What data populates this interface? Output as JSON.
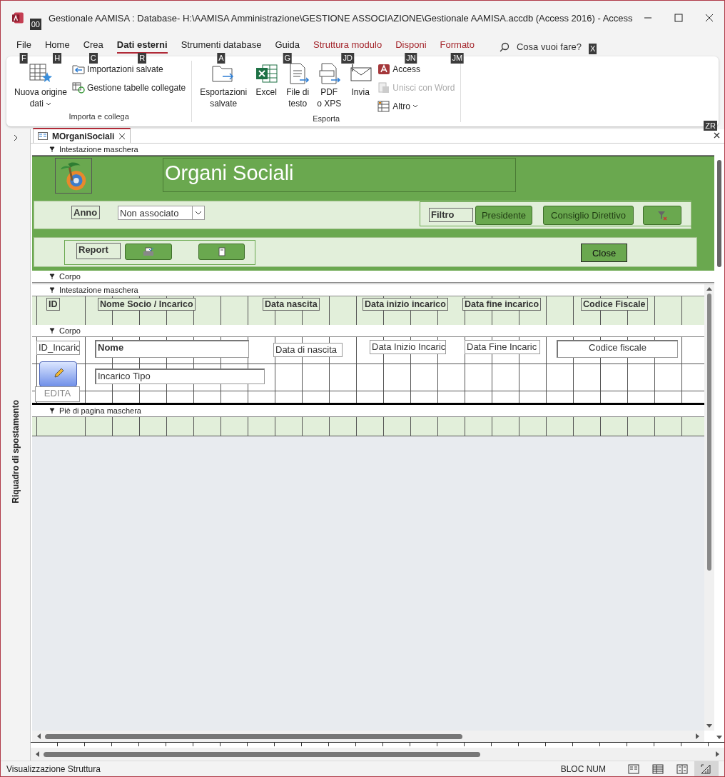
{
  "window": {
    "title": "Gestionale AAMISA : Database- H:\\AAMISA Amministrazione\\GESTIONE ASSOCIAZIONE\\Gestionale AAMISA.accdb (Access 2016)  -  Access",
    "qat_keytip": "00"
  },
  "menu_tabs": [
    {
      "label": "File",
      "keytip": "F",
      "selected": false,
      "kind": "normal"
    },
    {
      "label": "Home",
      "keytip": "H",
      "selected": false,
      "kind": "normal"
    },
    {
      "label": "Crea",
      "keytip": "C",
      "selected": false,
      "kind": "normal"
    },
    {
      "label": "Dati esterni",
      "keytip": "R",
      "selected": true,
      "kind": "normal"
    },
    {
      "label": "Strumenti database",
      "keytip": "A",
      "selected": false,
      "kind": "normal"
    },
    {
      "label": "Guida",
      "keytip": "G",
      "selected": false,
      "kind": "normal"
    },
    {
      "label": "Struttura modulo",
      "keytip": "JD",
      "selected": false,
      "kind": "contextual"
    },
    {
      "label": "Disponi",
      "keytip": "JN",
      "selected": false,
      "kind": "contextual"
    },
    {
      "label": "Formato",
      "keytip": "JM",
      "selected": false,
      "kind": "contextual"
    }
  ],
  "tell_me": {
    "placeholder": "Cosa vuoi fare?",
    "keytip": "X"
  },
  "ribbon": {
    "collapse_keytip": "ZR",
    "groups": [
      {
        "label": "Importa e collega",
        "items": [
          {
            "kind": "large",
            "lines": [
              "Nuova origine",
              "dati"
            ],
            "dropdown": true,
            "disabled": false
          },
          {
            "kind": "small",
            "label": "Importazioni salvate",
            "dropdown": false,
            "disabled": false
          },
          {
            "kind": "small",
            "label": "Gestione tabelle collegate",
            "dropdown": false,
            "disabled": false
          }
        ]
      },
      {
        "label": "Esporta",
        "items": [
          {
            "kind": "large",
            "lines": [
              "Esportazioni",
              "salvate"
            ],
            "dropdown": false,
            "disabled": false
          },
          {
            "kind": "large",
            "lines": [
              "Excel"
            ],
            "dropdown": false,
            "disabled": false
          },
          {
            "kind": "large",
            "lines": [
              "File di",
              "testo"
            ],
            "dropdown": false,
            "disabled": false
          },
          {
            "kind": "large",
            "lines": [
              "PDF",
              "o XPS"
            ],
            "dropdown": false,
            "disabled": false
          },
          {
            "kind": "large",
            "lines": [
              "Invia"
            ],
            "dropdown": false,
            "disabled": false
          },
          {
            "kind": "small",
            "label": "Access",
            "dropdown": false,
            "disabled": false
          },
          {
            "kind": "small",
            "label": "Unisci con Word",
            "dropdown": false,
            "disabled": true
          },
          {
            "kind": "small",
            "label": "Altro",
            "dropdown": true,
            "disabled": false
          }
        ]
      }
    ]
  },
  "navigation_pane": {
    "label": "Riquadro di spostamento"
  },
  "document_tab": {
    "label": "MOrganiSociali",
    "selected": true
  },
  "form_header": {
    "section_label": "Intestazione maschera",
    "title": "Organi Sociali",
    "anno_label": "Anno",
    "anno_value": "Non associato",
    "filter_label": "Filtro",
    "filter_buttons": [
      {
        "kind": "text",
        "label": "Presidente"
      },
      {
        "kind": "text",
        "label": "Consiglio Direttivo"
      },
      {
        "kind": "icon"
      }
    ],
    "report_label": "Report",
    "report_buttons": [
      {
        "kind": "icon"
      },
      {
        "kind": "icon"
      }
    ],
    "close_button": "Close"
  },
  "detail_section_label": "Corpo",
  "subform": {
    "header_section_label": "Intestazione maschera",
    "column_labels": [
      "ID",
      "Nome Socio / Incarico",
      "Data nascita",
      "Data inizio incarico",
      "Data fine incarico",
      "Codice Fiscale"
    ],
    "detail_section_label": "Corpo",
    "fields": [
      {
        "kind": "field",
        "value": "ID_Incaric"
      },
      {
        "kind": "bold",
        "value": "Nome"
      },
      {
        "kind": "field",
        "value": "Data di nascita"
      },
      {
        "kind": "field",
        "value": "Data Inizio Incaric"
      },
      {
        "kind": "field",
        "value": "Data Fine Incaric"
      },
      {
        "kind": "center",
        "value": "Codice fiscale"
      },
      {
        "kind": "field",
        "value": "Incarico Tipo"
      }
    ],
    "edit_label": "EDITA",
    "footer_section_label": "Piè di pagina maschera"
  },
  "status_bar": {
    "text": "Visualizzazione Struttura",
    "indicator": "BLOC NUM",
    "views": [
      {
        "selected": false
      },
      {
        "selected": false
      },
      {
        "selected": false
      },
      {
        "selected": true
      }
    ]
  }
}
